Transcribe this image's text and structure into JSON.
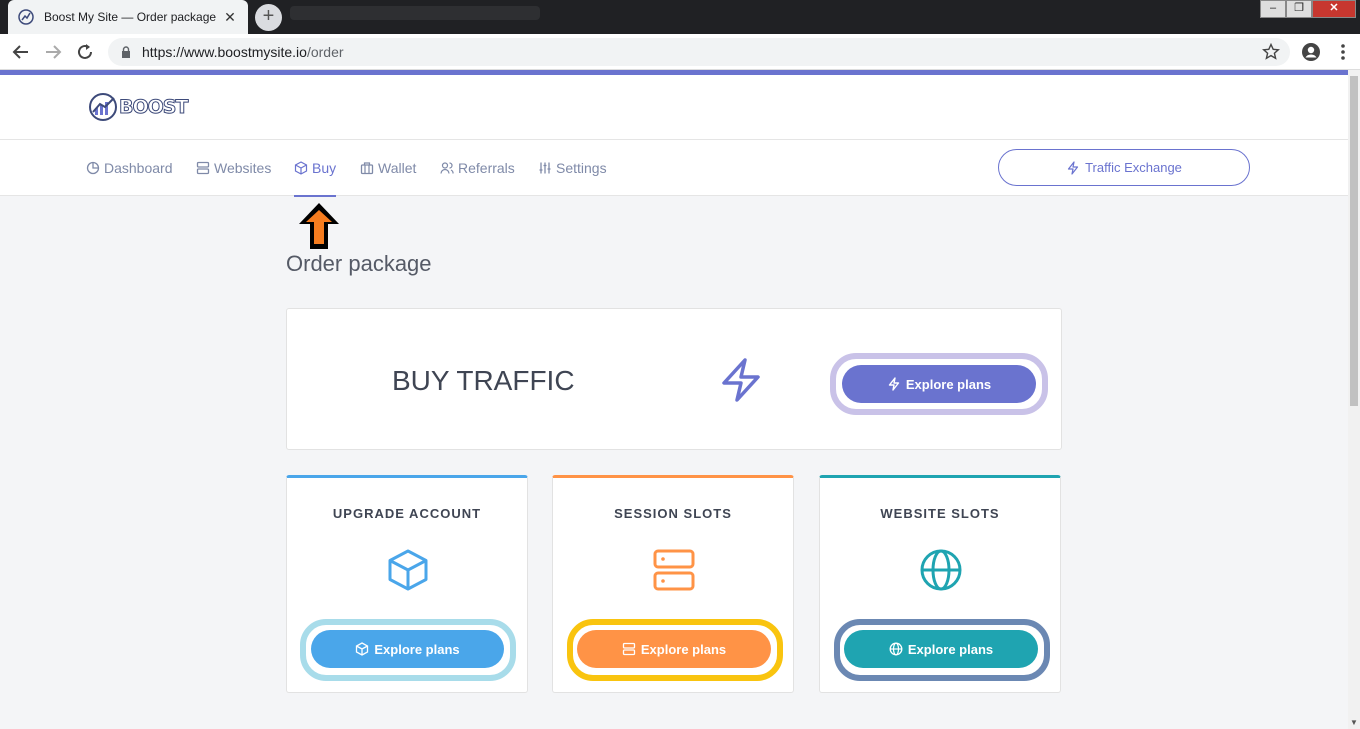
{
  "browser": {
    "tab_title": "Boost My Site — Order package",
    "tab_close": "✕",
    "new_tab": "+",
    "url_host": "https://www.boostmysite.io",
    "url_path": "/order",
    "win_minimize": "–",
    "win_restore": "❐",
    "win_close": "✕"
  },
  "site": {
    "logo_text": "BOOST",
    "nav": [
      {
        "label": "Dashboard",
        "icon": "pie-chart-icon"
      },
      {
        "label": "Websites",
        "icon": "server-icon"
      },
      {
        "label": "Buy",
        "icon": "box-icon",
        "active": true
      },
      {
        "label": "Wallet",
        "icon": "wallet-icon"
      },
      {
        "label": "Referrals",
        "icon": "users-icon"
      },
      {
        "label": "Settings",
        "icon": "sliders-icon"
      }
    ],
    "traffic_exchange_label": "Traffic Exchange"
  },
  "page": {
    "title": "Order package",
    "buy_traffic": {
      "title": "BUY TRAFFIC",
      "button": "Explore plans"
    },
    "cards": [
      {
        "title": "UPGRADE ACCOUNT",
        "button": "Explore plans",
        "icon": "box-icon"
      },
      {
        "title": "SESSION SLOTS",
        "button": "Explore plans",
        "icon": "server-icon"
      },
      {
        "title": "WEBSITE SLOTS",
        "button": "Explore plans",
        "icon": "globe-icon"
      }
    ]
  },
  "colors": {
    "accent": "#6a73cf",
    "blue": "#4aa6ea",
    "orange": "#ff9346",
    "teal": "#1fa4b1"
  }
}
